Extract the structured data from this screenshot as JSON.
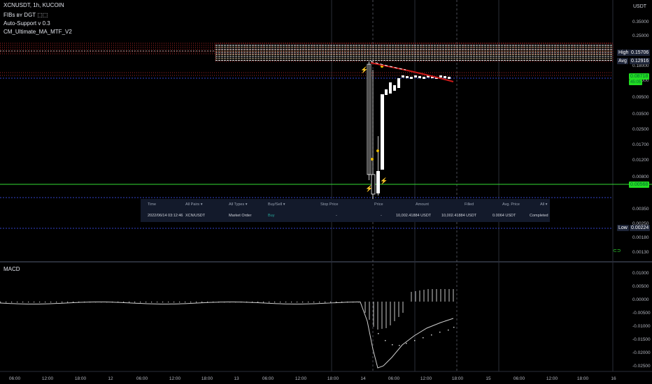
{
  "legend": {
    "symbol": "XCNUSDT, 1h, KUCOIN",
    "indicators": [
      "FIBs ʙʏ DGT ⬚⬚",
      "Auto-Support v 0.3",
      "CM_Ultimate_MA_MTF_V2"
    ]
  },
  "price_axis": {
    "currency": "USDT",
    "ticks": [
      "0.35000",
      "0.25000",
      "0.18000",
      "0.13000",
      "0.09500",
      "0.03500",
      "0.02500",
      "0.01700",
      "0.01200",
      "0.00800",
      "0.00350",
      "0.00250",
      "0.00180",
      "0.00130"
    ],
    "labels": {
      "high_label": "High",
      "high_value": "0.15706",
      "avg_label": "Avg",
      "avg_value": "0.12916",
      "low_label": "Low",
      "low_value": "0.00224",
      "green_top": "0.08718",
      "green_top_sub": "45:05",
      "green_bottom": "0.00568"
    }
  },
  "macd": {
    "title": "MACD",
    "ticks": [
      "0.01000",
      "0.00500",
      "0.00000",
      "-0.00500",
      "-0.01000",
      "-0.01500",
      "-0.02000",
      "-0.02500"
    ]
  },
  "time_axis": [
    "06:00",
    "12:00",
    "18:00",
    "12",
    "06:00",
    "12:00",
    "18:00",
    "13",
    "06:00",
    "12:00",
    "18:00",
    "14",
    "06:00",
    "12:00",
    "18:00",
    "15",
    "06:00",
    "12:00",
    "18:00",
    "16"
  ],
  "order_table": {
    "headers": {
      "time": "Time",
      "pairs": "All Pairs ▾",
      "types": "All Types ▾",
      "side": "Buy/Sell ▾",
      "stop": "Stop Price",
      "price": "Price",
      "amount": "Amount",
      "filled": "Filled",
      "avg": "Avg. Price",
      "status": "All ▾"
    },
    "row": {
      "time": "2022/06/14 03:12:46",
      "pair": "XCN/USDT",
      "type": "Market Order",
      "side": "Buy",
      "stop": "-",
      "price": "-",
      "amount": "10,002.41884 USDT",
      "filled": "10,002.41884 USDT",
      "avg": "0.0064 USDT",
      "status": "Completed"
    }
  },
  "colors": {
    "background": "#000000",
    "fib_red": "#e03030",
    "green_line": "#33dd33",
    "blue_dashed": "#3344cc",
    "ma_red": "#cc1a1a",
    "table_bg": "#131a2b"
  }
}
